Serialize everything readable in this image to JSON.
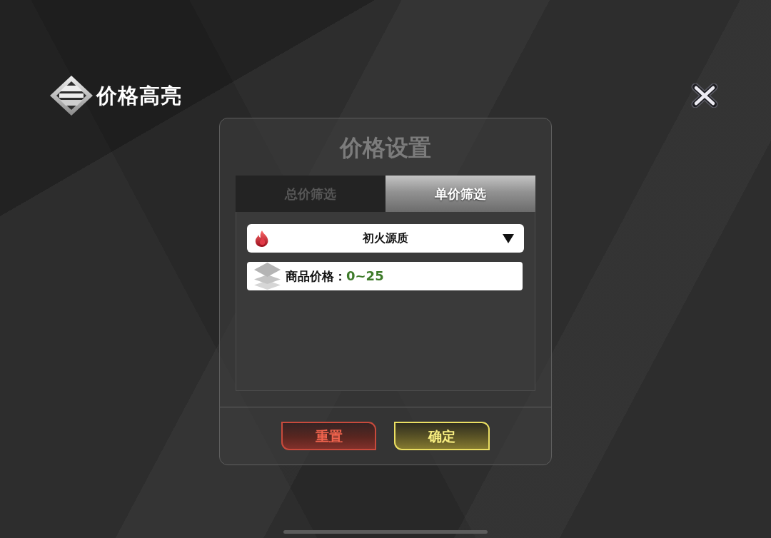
{
  "header": {
    "title": "价格高亮"
  },
  "dialog": {
    "title": "价格设置",
    "tabs": [
      {
        "label": "总价筛选",
        "selected": false
      },
      {
        "label": "单价筛选",
        "selected": true
      }
    ],
    "item_select": {
      "value": "初火源质"
    },
    "price_row": {
      "label": "商品价格：",
      "value": "0~25"
    },
    "buttons": [
      {
        "label": "重置",
        "kind": "reset"
      },
      {
        "label": "确定",
        "kind": "confirm"
      }
    ]
  }
}
